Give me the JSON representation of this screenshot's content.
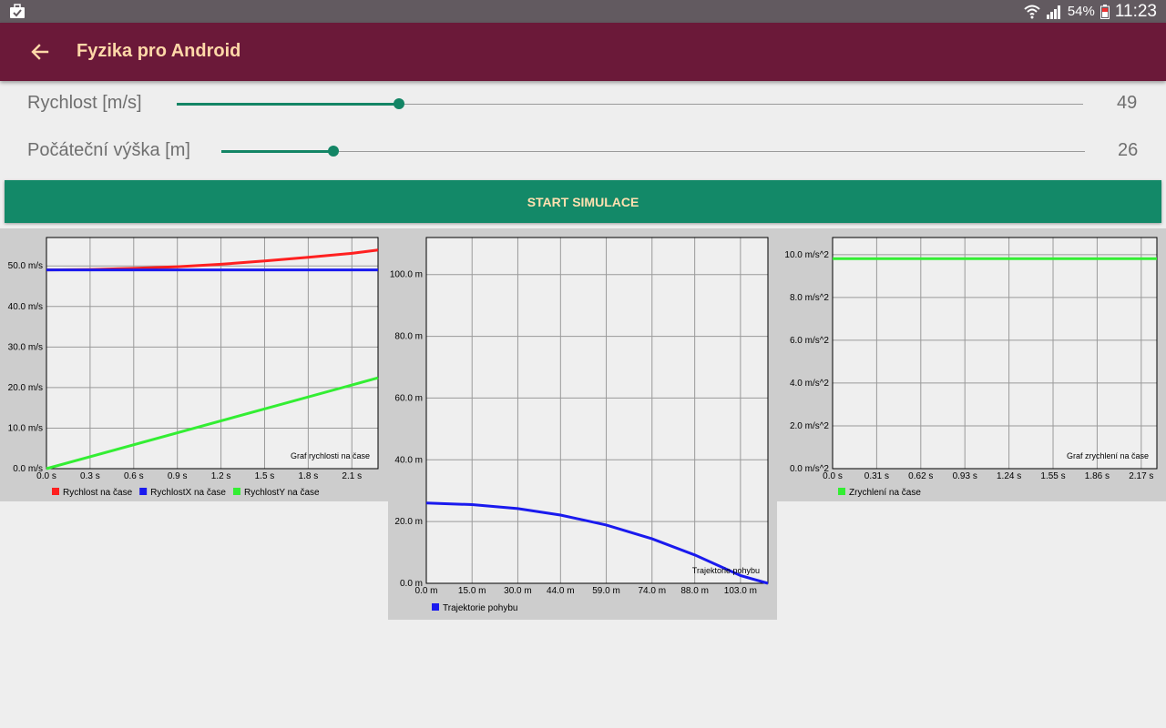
{
  "status_bar": {
    "battery": "54%",
    "time": "11:23",
    "icons": [
      "briefcase-icon",
      "wifi-icon",
      "signal-icon",
      "battery-icon"
    ]
  },
  "toolbar": {
    "back_icon": "arrow-left-icon",
    "title": "Fyzika pro Android"
  },
  "sliders": [
    {
      "label": "Rychlost [m/s]",
      "value": "49",
      "fraction": 0.245
    },
    {
      "label": "Počáteční výška [m]",
      "value": "26",
      "fraction": 0.13
    }
  ],
  "start_button": {
    "label": "START SIMULACE"
  },
  "colors": {
    "toolbar": "#6b1939",
    "accent": "#138968",
    "title_text": "#ffd8a8",
    "red": "#ff2020",
    "blue": "#1a1aee",
    "green": "#33ee33"
  },
  "chart_data": [
    {
      "type": "line",
      "annotation": "Graf rychlosti na čase",
      "xlim": [
        0,
        2.28
      ],
      "ylim": [
        0,
        57
      ],
      "x_ticks": [
        0,
        0.3,
        0.6,
        0.9,
        1.2,
        1.5,
        1.8,
        2.1
      ],
      "x_tick_labels": [
        "0.0 s",
        "0.3 s",
        "0.6 s",
        "0.9 s",
        "1.2 s",
        "1.5 s",
        "1.8 s",
        "2.1 s"
      ],
      "y_ticks": [
        0,
        10,
        20,
        30,
        40,
        50
      ],
      "y_tick_labels": [
        "0.0 m/s",
        "10.0 m/s",
        "20.0 m/s",
        "30.0 m/s",
        "40.0 m/s",
        "50.0 m/s"
      ],
      "grid": true,
      "legend_position": "bottom",
      "series": [
        {
          "name": "Rychlost na čase",
          "color": "#ff2020",
          "x": [
            0,
            0.3,
            0.6,
            0.9,
            1.2,
            1.5,
            1.8,
            2.1,
            2.28
          ],
          "y": [
            49.0,
            49.1,
            49.4,
            49.8,
            50.4,
            51.2,
            52.1,
            53.1,
            53.9
          ]
        },
        {
          "name": "RychlostX na čase",
          "color": "#1a1aee",
          "x": [
            0,
            2.28
          ],
          "y": [
            49.0,
            49.0
          ]
        },
        {
          "name": "RychlostY na čase",
          "color": "#33ee33",
          "x": [
            0,
            2.28
          ],
          "y": [
            0.0,
            22.4
          ]
        }
      ]
    },
    {
      "type": "line",
      "annotation": "Trajektorie pohybu",
      "xlim": [
        0,
        112
      ],
      "ylim": [
        0,
        112
      ],
      "x_ticks": [
        0,
        15,
        30,
        44,
        59,
        74,
        88,
        103
      ],
      "x_tick_labels": [
        "0.0 m",
        "15.0 m",
        "30.0 m",
        "44.0 m",
        "59.0 m",
        "74.0 m",
        "88.0 m",
        "103.0 m"
      ],
      "y_ticks": [
        0,
        20,
        40,
        60,
        80,
        100
      ],
      "y_tick_labels": [
        "0.0 m",
        "20.0 m",
        "40.0 m",
        "60.0 m",
        "80.0 m",
        "100.0 m"
      ],
      "grid": true,
      "legend_position": "bottom",
      "series": [
        {
          "name": "Trajektorie pohybu",
          "color": "#1a1aee",
          "x": [
            0,
            15,
            30,
            44,
            59,
            74,
            88,
            103,
            112
          ],
          "y": [
            26.0,
            25.5,
            24.2,
            22.1,
            18.9,
            14.4,
            9.2,
            2.5,
            0.0
          ]
        }
      ]
    },
    {
      "type": "line",
      "annotation": "Graf zrychlení na čase",
      "xlim": [
        0,
        2.28
      ],
      "ylim": [
        0,
        10.8
      ],
      "x_ticks": [
        0,
        0.31,
        0.62,
        0.93,
        1.24,
        1.55,
        1.86,
        2.17
      ],
      "x_tick_labels": [
        "0.0 s",
        "0.31 s",
        "0.62 s",
        "0.93 s",
        "1.24 s",
        "1.55 s",
        "1.86 s",
        "2.17 s"
      ],
      "y_ticks": [
        0,
        2,
        4,
        6,
        8,
        10
      ],
      "y_tick_labels": [
        "0.0 m/s^2",
        "2.0 m/s^2",
        "4.0 m/s^2",
        "6.0 m/s^2",
        "8.0 m/s^2",
        "10.0 m/s^2"
      ],
      "grid": true,
      "legend_position": "bottom",
      "series": [
        {
          "name": "Zrychlení na čase",
          "color": "#33ee33",
          "x": [
            0,
            2.28
          ],
          "y": [
            9.81,
            9.81
          ]
        }
      ]
    }
  ]
}
